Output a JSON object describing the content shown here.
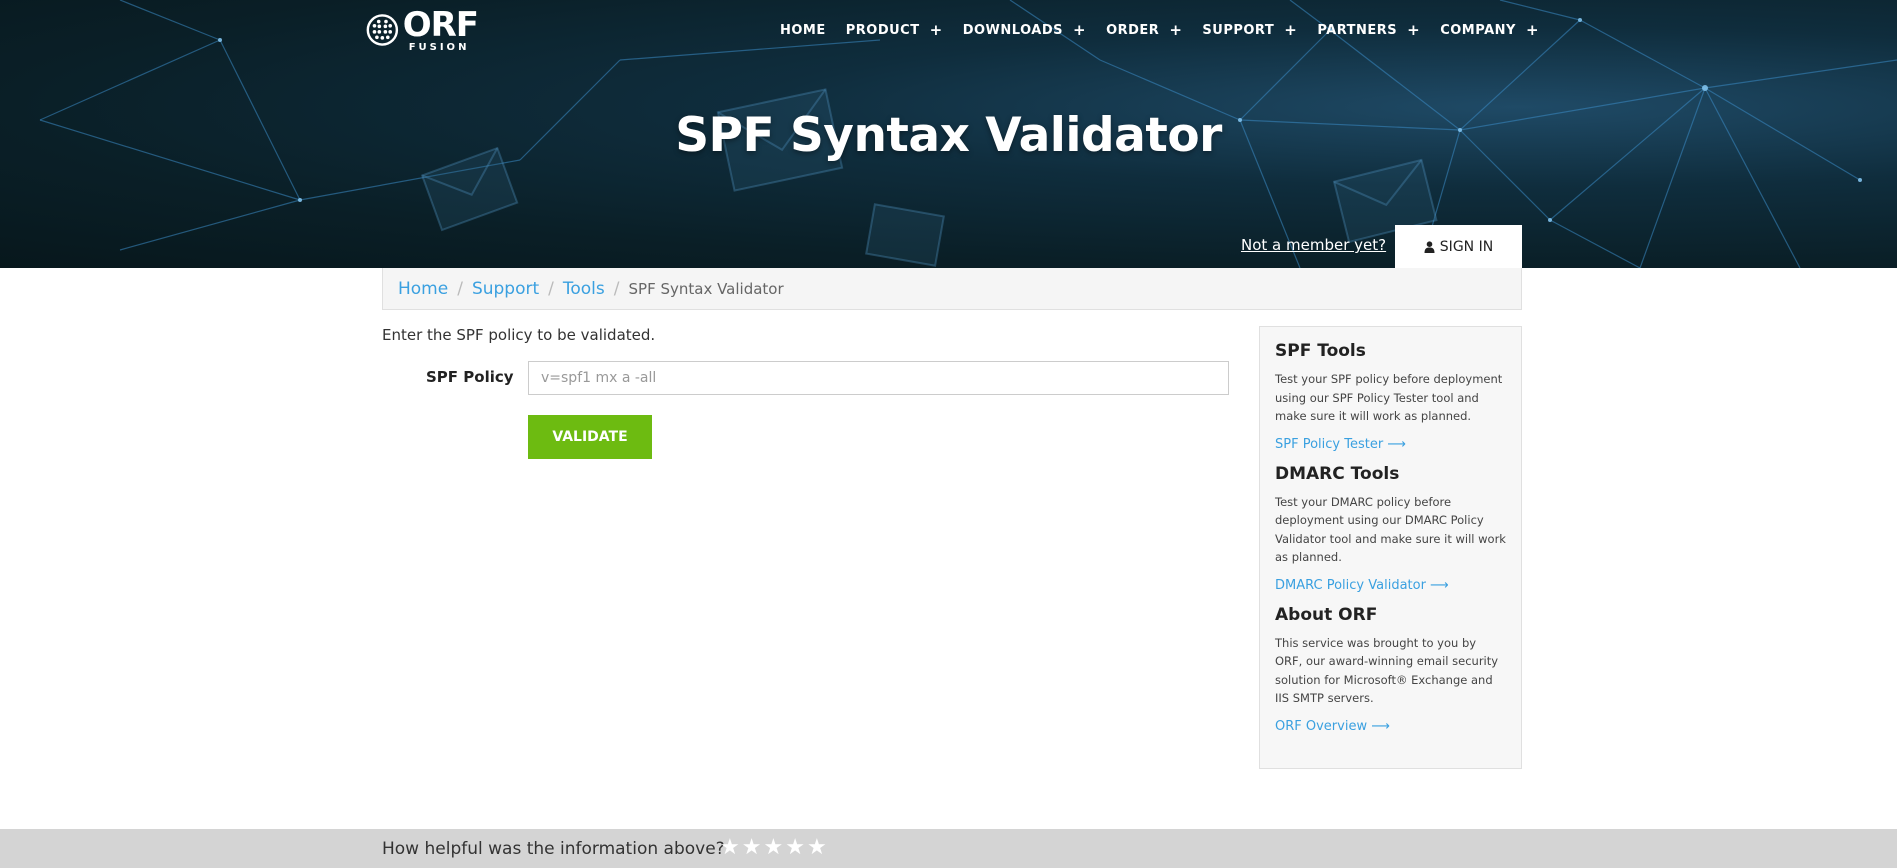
{
  "logo": {
    "text": "ORF",
    "subtext": "FUSION"
  },
  "nav": {
    "items": [
      {
        "label": "HOME",
        "has_plus": false
      },
      {
        "label": "PRODUCT",
        "has_plus": true
      },
      {
        "label": "DOWNLOADS",
        "has_plus": true
      },
      {
        "label": "ORDER",
        "has_plus": true
      },
      {
        "label": "SUPPORT",
        "has_plus": true
      },
      {
        "label": "PARTNERS",
        "has_plus": true
      },
      {
        "label": "COMPANY",
        "has_plus": true
      }
    ],
    "plus_glyph": "+"
  },
  "hero": {
    "title": "SPF Syntax Validator"
  },
  "auth": {
    "member_link": "Not a member yet?",
    "signin_label": "SIGN IN"
  },
  "breadcrumb": {
    "items": [
      "Home",
      "Support",
      "Tools"
    ],
    "current": "SPF Syntax Validator",
    "separator": "/"
  },
  "main": {
    "intro": "Enter the SPF policy to be validated.",
    "spf_label": "SPF Policy",
    "spf_placeholder": "v=spf1 mx a -all",
    "spf_value": "",
    "validate_label": "VALIDATE"
  },
  "sidebar": {
    "sections": [
      {
        "title": "SPF Tools",
        "text": "Test your SPF policy before deployment using our SPF Policy Tester tool and make sure it will work as planned.",
        "link": "SPF Policy Tester ⟶"
      },
      {
        "title": "DMARC Tools",
        "text": "Test your DMARC policy before deployment using our DMARC Policy Validator tool and make sure it will work as planned.",
        "link": "DMARC Policy Validator ⟶"
      },
      {
        "title": "About ORF",
        "text": "This service was brought to you by ORF, our award-winning email security solution for Microsoft® Exchange and IIS SMTP servers.",
        "link": "ORF Overview ⟶"
      }
    ]
  },
  "feedback": {
    "question": "How helpful was the information above?",
    "star_glyph": "★",
    "star_count": 5
  },
  "colors": {
    "accent_blue": "#3aa0e0",
    "validate_green": "#6dbb11",
    "hero_dark": "#0a1f27"
  }
}
